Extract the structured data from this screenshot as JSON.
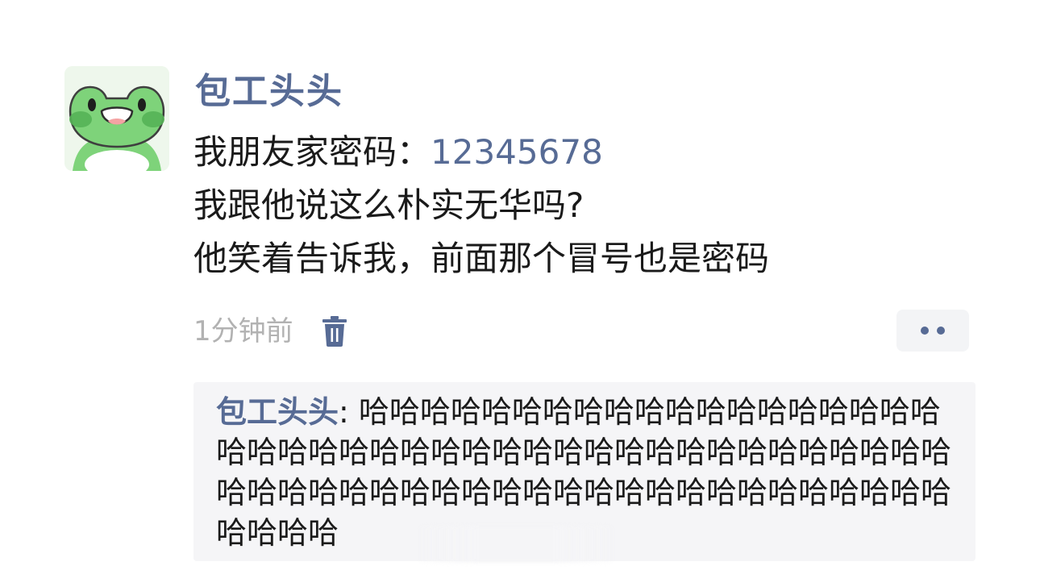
{
  "post": {
    "username": "包工头头",
    "text_lines": [
      "我朋友家密码：",
      "我跟他说这么朴实无华吗?",
      "他笑着告诉我，前面那个冒号也是密码"
    ],
    "password_link": "12345678",
    "timestamp": "1分钟前",
    "icons": {
      "avatar": "frog-avatar",
      "delete": "trash-icon",
      "more": "more-dots-icon"
    }
  },
  "comments": [
    {
      "author": "包工头头",
      "separator": ": ",
      "text": "哈哈哈哈哈哈哈哈哈哈哈哈哈哈哈哈哈哈哈哈哈哈哈哈哈哈哈哈哈哈哈哈哈哈哈哈哈哈哈哈哈哈哈哈哈哈哈哈哈哈哈哈哈哈哈哈哈哈哈哈哈哈哈哈哈哈哈哈哈哈哈"
    }
  ],
  "colors": {
    "link": "#576b95",
    "text": "#1a1a1a",
    "muted": "#b2b2b2",
    "comment_bg": "#f5f5f7",
    "avatar_green": "#7ed37a"
  }
}
